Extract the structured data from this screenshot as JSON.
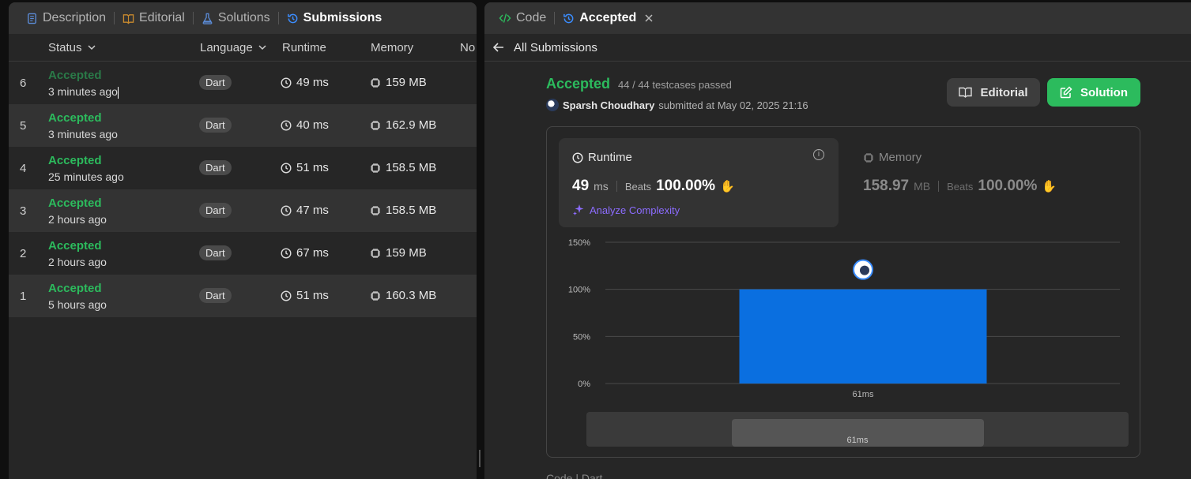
{
  "left_tabs": [
    {
      "label": "Description",
      "icon": "document-icon",
      "color": "#5b8bd6"
    },
    {
      "label": "Editorial",
      "icon": "book-icon",
      "color": "#c98a2e"
    },
    {
      "label": "Solutions",
      "icon": "flask-icon",
      "color": "#5b8bd6"
    },
    {
      "label": "Submissions",
      "icon": "history-icon",
      "color": "#3b8dff"
    }
  ],
  "columns": {
    "status": "Status",
    "language": "Language",
    "runtime": "Runtime",
    "memory": "Memory",
    "notes": "No"
  },
  "submissions": [
    {
      "num": "6",
      "status": "Accepted",
      "ago": "3 minutes ago",
      "lang": "Dart",
      "runtime": "49 ms",
      "memory": "159 MB"
    },
    {
      "num": "5",
      "status": "Accepted",
      "ago": "3 minutes ago",
      "lang": "Dart",
      "runtime": "40 ms",
      "memory": "162.9 MB"
    },
    {
      "num": "4",
      "status": "Accepted",
      "ago": "25 minutes ago",
      "lang": "Dart",
      "runtime": "51 ms",
      "memory": "158.5 MB"
    },
    {
      "num": "3",
      "status": "Accepted",
      "ago": "2 hours ago",
      "lang": "Dart",
      "runtime": "47 ms",
      "memory": "158.5 MB"
    },
    {
      "num": "2",
      "status": "Accepted",
      "ago": "2 hours ago",
      "lang": "Dart",
      "runtime": "67 ms",
      "memory": "159 MB"
    },
    {
      "num": "1",
      "status": "Accepted",
      "ago": "5 hours ago",
      "lang": "Dart",
      "runtime": "51 ms",
      "memory": "160.3 MB"
    }
  ],
  "right_tabs": {
    "code": "Code",
    "accepted": "Accepted"
  },
  "back_label": "All Submissions",
  "result": {
    "status": "Accepted",
    "testcases": "44 / 44 testcases passed",
    "user": "Sparsh Choudhary",
    "submitted": "submitted at May 02, 2025 21:16",
    "editorial_btn": "Editorial",
    "solution_btn": "Solution"
  },
  "runtime": {
    "label": "Runtime",
    "value": "49",
    "unit": "ms",
    "beats_label": "Beats",
    "beats": "100.00%",
    "analyze": "Analyze Complexity"
  },
  "memory": {
    "label": "Memory",
    "value": "158.97",
    "unit": "MB",
    "beats_label": "Beats",
    "beats": "100.00%"
  },
  "chart_data": {
    "type": "bar",
    "categories": [
      "61ms"
    ],
    "values": [
      100
    ],
    "ylim": [
      0,
      150
    ],
    "yticks": [
      "0%",
      "50%",
      "100%",
      "150%"
    ],
    "range_label": "61ms",
    "bar_color": "#0a6fe0"
  },
  "bottom_text": "Code | Dart"
}
